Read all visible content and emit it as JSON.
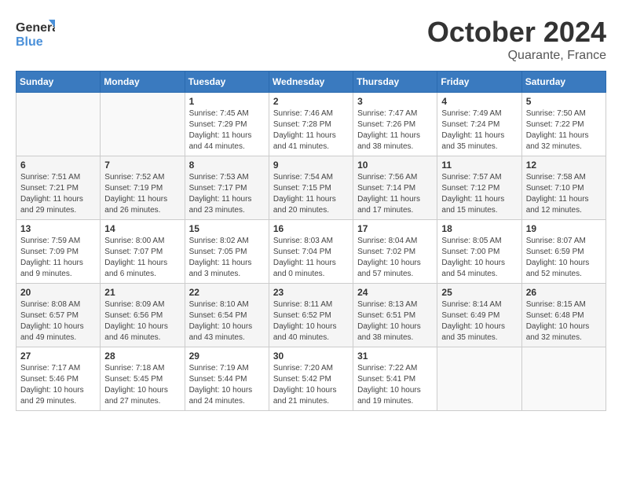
{
  "header": {
    "logo_general": "General",
    "logo_blue": "Blue",
    "month": "October 2024",
    "location": "Quarante, France"
  },
  "weekdays": [
    "Sunday",
    "Monday",
    "Tuesday",
    "Wednesday",
    "Thursday",
    "Friday",
    "Saturday"
  ],
  "weeks": [
    [
      {
        "day": "",
        "sunrise": "",
        "sunset": "",
        "daylight": ""
      },
      {
        "day": "",
        "sunrise": "",
        "sunset": "",
        "daylight": ""
      },
      {
        "day": "1",
        "sunrise": "Sunrise: 7:45 AM",
        "sunset": "Sunset: 7:29 PM",
        "daylight": "Daylight: 11 hours and 44 minutes."
      },
      {
        "day": "2",
        "sunrise": "Sunrise: 7:46 AM",
        "sunset": "Sunset: 7:28 PM",
        "daylight": "Daylight: 11 hours and 41 minutes."
      },
      {
        "day": "3",
        "sunrise": "Sunrise: 7:47 AM",
        "sunset": "Sunset: 7:26 PM",
        "daylight": "Daylight: 11 hours and 38 minutes."
      },
      {
        "day": "4",
        "sunrise": "Sunrise: 7:49 AM",
        "sunset": "Sunset: 7:24 PM",
        "daylight": "Daylight: 11 hours and 35 minutes."
      },
      {
        "day": "5",
        "sunrise": "Sunrise: 7:50 AM",
        "sunset": "Sunset: 7:22 PM",
        "daylight": "Daylight: 11 hours and 32 minutes."
      }
    ],
    [
      {
        "day": "6",
        "sunrise": "Sunrise: 7:51 AM",
        "sunset": "Sunset: 7:21 PM",
        "daylight": "Daylight: 11 hours and 29 minutes."
      },
      {
        "day": "7",
        "sunrise": "Sunrise: 7:52 AM",
        "sunset": "Sunset: 7:19 PM",
        "daylight": "Daylight: 11 hours and 26 minutes."
      },
      {
        "day": "8",
        "sunrise": "Sunrise: 7:53 AM",
        "sunset": "Sunset: 7:17 PM",
        "daylight": "Daylight: 11 hours and 23 minutes."
      },
      {
        "day": "9",
        "sunrise": "Sunrise: 7:54 AM",
        "sunset": "Sunset: 7:15 PM",
        "daylight": "Daylight: 11 hours and 20 minutes."
      },
      {
        "day": "10",
        "sunrise": "Sunrise: 7:56 AM",
        "sunset": "Sunset: 7:14 PM",
        "daylight": "Daylight: 11 hours and 17 minutes."
      },
      {
        "day": "11",
        "sunrise": "Sunrise: 7:57 AM",
        "sunset": "Sunset: 7:12 PM",
        "daylight": "Daylight: 11 hours and 15 minutes."
      },
      {
        "day": "12",
        "sunrise": "Sunrise: 7:58 AM",
        "sunset": "Sunset: 7:10 PM",
        "daylight": "Daylight: 11 hours and 12 minutes."
      }
    ],
    [
      {
        "day": "13",
        "sunrise": "Sunrise: 7:59 AM",
        "sunset": "Sunset: 7:09 PM",
        "daylight": "Daylight: 11 hours and 9 minutes."
      },
      {
        "day": "14",
        "sunrise": "Sunrise: 8:00 AM",
        "sunset": "Sunset: 7:07 PM",
        "daylight": "Daylight: 11 hours and 6 minutes."
      },
      {
        "day": "15",
        "sunrise": "Sunrise: 8:02 AM",
        "sunset": "Sunset: 7:05 PM",
        "daylight": "Daylight: 11 hours and 3 minutes."
      },
      {
        "day": "16",
        "sunrise": "Sunrise: 8:03 AM",
        "sunset": "Sunset: 7:04 PM",
        "daylight": "Daylight: 11 hours and 0 minutes."
      },
      {
        "day": "17",
        "sunrise": "Sunrise: 8:04 AM",
        "sunset": "Sunset: 7:02 PM",
        "daylight": "Daylight: 10 hours and 57 minutes."
      },
      {
        "day": "18",
        "sunrise": "Sunrise: 8:05 AM",
        "sunset": "Sunset: 7:00 PM",
        "daylight": "Daylight: 10 hours and 54 minutes."
      },
      {
        "day": "19",
        "sunrise": "Sunrise: 8:07 AM",
        "sunset": "Sunset: 6:59 PM",
        "daylight": "Daylight: 10 hours and 52 minutes."
      }
    ],
    [
      {
        "day": "20",
        "sunrise": "Sunrise: 8:08 AM",
        "sunset": "Sunset: 6:57 PM",
        "daylight": "Daylight: 10 hours and 49 minutes."
      },
      {
        "day": "21",
        "sunrise": "Sunrise: 8:09 AM",
        "sunset": "Sunset: 6:56 PM",
        "daylight": "Daylight: 10 hours and 46 minutes."
      },
      {
        "day": "22",
        "sunrise": "Sunrise: 8:10 AM",
        "sunset": "Sunset: 6:54 PM",
        "daylight": "Daylight: 10 hours and 43 minutes."
      },
      {
        "day": "23",
        "sunrise": "Sunrise: 8:11 AM",
        "sunset": "Sunset: 6:52 PM",
        "daylight": "Daylight: 10 hours and 40 minutes."
      },
      {
        "day": "24",
        "sunrise": "Sunrise: 8:13 AM",
        "sunset": "Sunset: 6:51 PM",
        "daylight": "Daylight: 10 hours and 38 minutes."
      },
      {
        "day": "25",
        "sunrise": "Sunrise: 8:14 AM",
        "sunset": "Sunset: 6:49 PM",
        "daylight": "Daylight: 10 hours and 35 minutes."
      },
      {
        "day": "26",
        "sunrise": "Sunrise: 8:15 AM",
        "sunset": "Sunset: 6:48 PM",
        "daylight": "Daylight: 10 hours and 32 minutes."
      }
    ],
    [
      {
        "day": "27",
        "sunrise": "Sunrise: 7:17 AM",
        "sunset": "Sunset: 5:46 PM",
        "daylight": "Daylight: 10 hours and 29 minutes."
      },
      {
        "day": "28",
        "sunrise": "Sunrise: 7:18 AM",
        "sunset": "Sunset: 5:45 PM",
        "daylight": "Daylight: 10 hours and 27 minutes."
      },
      {
        "day": "29",
        "sunrise": "Sunrise: 7:19 AM",
        "sunset": "Sunset: 5:44 PM",
        "daylight": "Daylight: 10 hours and 24 minutes."
      },
      {
        "day": "30",
        "sunrise": "Sunrise: 7:20 AM",
        "sunset": "Sunset: 5:42 PM",
        "daylight": "Daylight: 10 hours and 21 minutes."
      },
      {
        "day": "31",
        "sunrise": "Sunrise: 7:22 AM",
        "sunset": "Sunset: 5:41 PM",
        "daylight": "Daylight: 10 hours and 19 minutes."
      },
      {
        "day": "",
        "sunrise": "",
        "sunset": "",
        "daylight": ""
      },
      {
        "day": "",
        "sunrise": "",
        "sunset": "",
        "daylight": ""
      }
    ]
  ]
}
